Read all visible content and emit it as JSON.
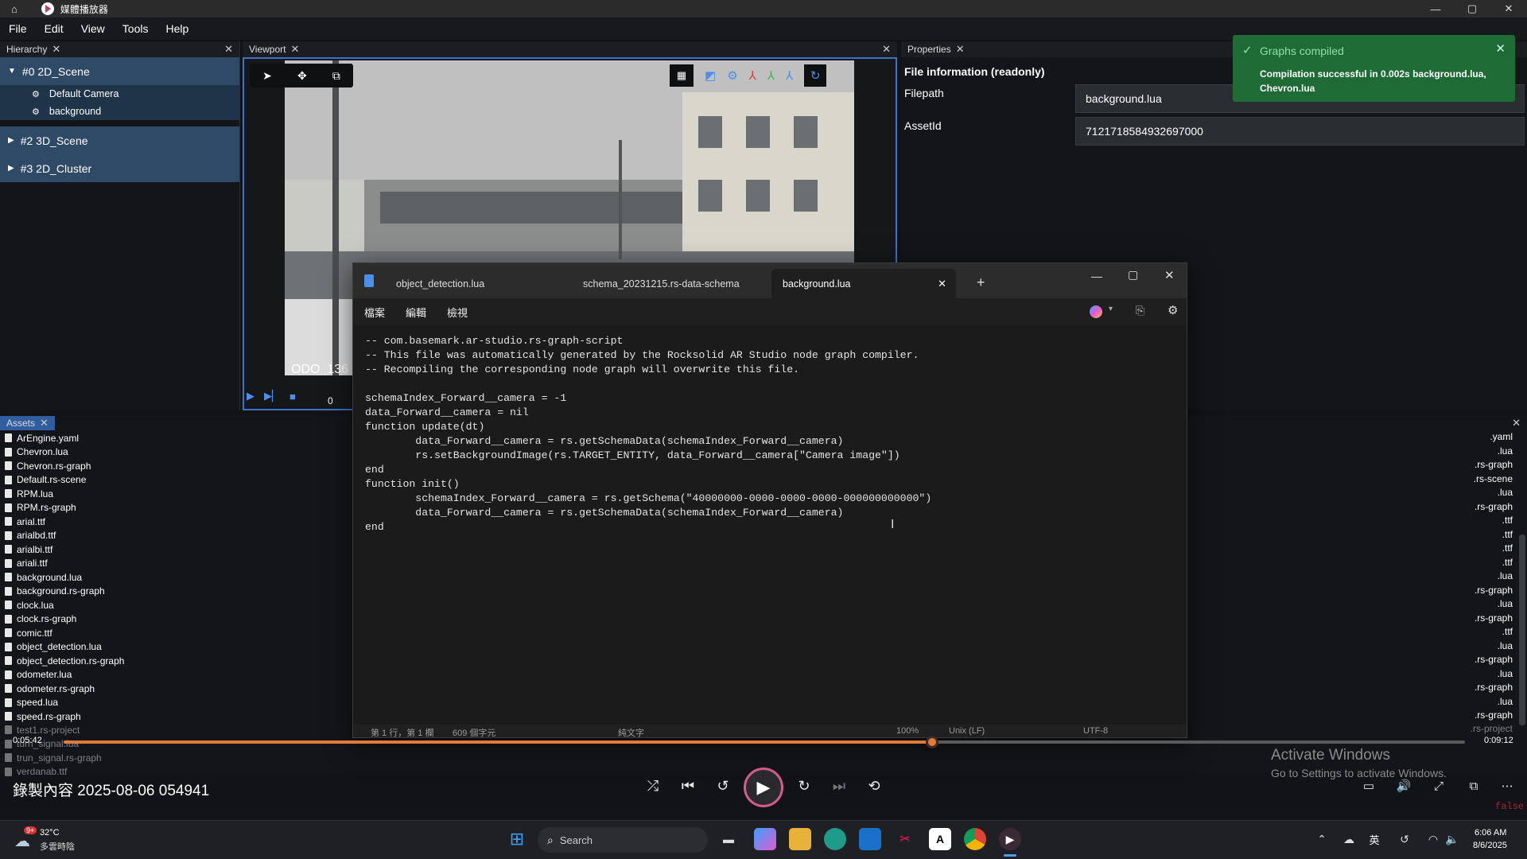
{
  "titlebar": {
    "title": "媒體播放器",
    "minimize": "—",
    "maximize": "▢",
    "close": "✕"
  },
  "menu": [
    "File",
    "Edit",
    "View",
    "Tools",
    "Help"
  ],
  "hierarchy": {
    "tab_label": "Hierarchy",
    "scenes": [
      {
        "label": "#0 2D_Scene",
        "children": [
          "Default Camera",
          "background"
        ]
      },
      {
        "label": "#2 3D_Scene",
        "children": []
      },
      {
        "label": "#3 2D_Cluster",
        "children": []
      }
    ]
  },
  "viewport": {
    "tab_label": "Viewport",
    "odo_text": "ODO  136",
    "frame_counter": "0"
  },
  "properties": {
    "tab_label": "Properties",
    "section_title": "File information (readonly)",
    "fields": [
      {
        "label": "Filepath",
        "value": "background.lua"
      },
      {
        "label": "AssetId",
        "value": "7121718584932697000"
      }
    ]
  },
  "toast": {
    "title": "Graphs compiled",
    "message": "Compilation successful in 0.002s background.lua, Chevron.lua",
    "accent": "#1e6b36"
  },
  "assets": {
    "tab_label": "Assets",
    "files": [
      "ArEngine.yaml",
      "Chevron.lua",
      "Chevron.rs-graph",
      "Default.rs-scene",
      "RPM.lua",
      "RPM.rs-graph",
      "arial.ttf",
      "arialbd.ttf",
      "arialbi.ttf",
      "ariali.ttf",
      "background.lua",
      "background.rs-graph",
      "clock.lua",
      "clock.rs-graph",
      "comic.ttf",
      "object_detection.lua",
      "object_detection.rs-graph",
      "odometer.lua",
      "odometer.rs-graph",
      "speed.lua",
      "speed.rs-graph"
    ],
    "faded_files": [
      "test1.rs-project",
      "turn_signal.lua",
      "trun_signal.rs-graph",
      "verdanab.ttf"
    ],
    "extensions": [
      ".yaml",
      ".lua",
      ".rs-graph",
      ".rs-scene",
      ".lua",
      ".rs-graph",
      ".ttf",
      ".ttf",
      ".ttf",
      ".ttf",
      ".lua",
      ".rs-graph",
      ".lua",
      ".rs-graph",
      ".ttf",
      ".lua",
      ".rs-graph",
      ".lua",
      ".rs-graph",
      ".lua",
      ".rs-graph"
    ],
    "faded_extensions": [
      ".rs-project"
    ]
  },
  "notepad": {
    "tabs": [
      "object_detection.lua",
      "schema_20231215.rs-data-schema",
      "background.lua"
    ],
    "active_tab": "background.lua",
    "new_tab": "+",
    "menu": [
      "檔案",
      "編輯",
      "檢視"
    ],
    "code": "-- com.basemark.ar-studio.rs-graph-script\n-- This file was automatically generated by the Rocksolid AR Studio node graph compiler.\n-- Recompiling the corresponding node graph will overwrite this file.\n\nschemaIndex_Forward__camera = -1\ndata_Forward__camera = nil\nfunction update(dt)\n        data_Forward__camera = rs.getSchemaData(schemaIndex_Forward__camera)\n        rs.setBackgroundImage(rs.TARGET_ENTITY, data_Forward__camera[\"Camera image\"])\nend\nfunction init()\n        schemaIndex_Forward__camera = rs.getSchema(\"40000000-0000-0000-0000-000000000000\")\n        data_Forward__camera = rs.getSchemaData(schemaIndex_Forward__camera)\nend",
    "status": {
      "position": "第 1 行，第 1 欄",
      "chars": "609 個字元",
      "format": "純文字",
      "zoom": "100%",
      "line_ending": "Unix (LF)",
      "encoding": "UTF-8"
    }
  },
  "player": {
    "elapsed": "0:05:42",
    "total": "0:09:12",
    "progress": 0.62,
    "media_title": "錄製內容 2025-08-06 054941",
    "watermark_title": "Activate Windows",
    "watermark_sub": "Go to Settings to activate Windows.",
    "corner_text": "false"
  },
  "taskbar": {
    "weather_temp": "32°C",
    "weather_desc": "多雲時陰",
    "weather_badge": "9+",
    "search_placeholder": "Search",
    "ime": "英",
    "time": "6:06 AM",
    "date": "8/6/2025"
  }
}
